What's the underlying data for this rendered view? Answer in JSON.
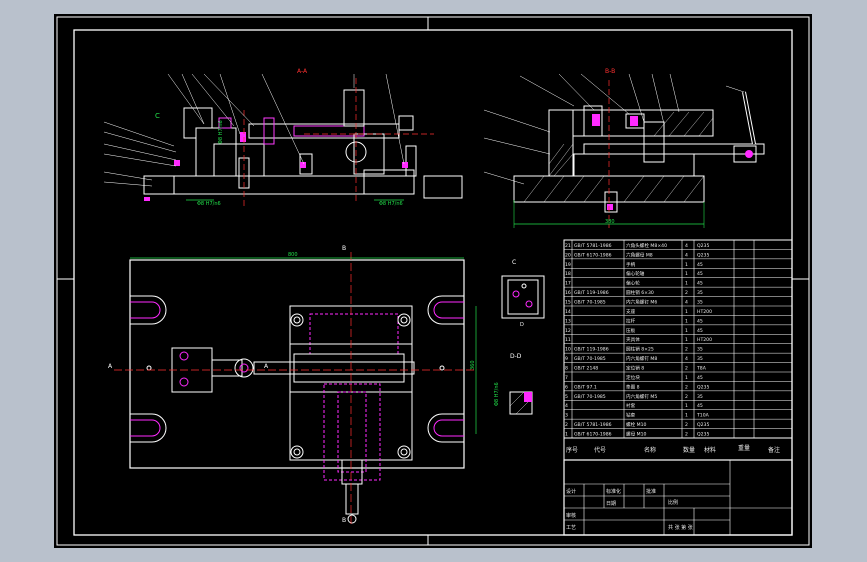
{
  "drawing": {
    "sections": {
      "section_a": "A-A",
      "section_b": "B-B",
      "section_c": "C",
      "section_d": "D-D"
    },
    "dimensions": {
      "plan_width": "800",
      "plan_height": "360",
      "section_b_width": "380",
      "fit_1": "Φ8 H7/n6",
      "fit_2": "Φ8 H7/n6",
      "fit_3": "Φ8 H7/n6",
      "fit_4": "Φ8 H7/n6"
    },
    "markers": {
      "a_left": "A",
      "a_right": "A",
      "b_top": "B",
      "b_bottom": "B",
      "c_top": "C",
      "c_bottom": "D",
      "c_left": "C"
    }
  },
  "parts_table": {
    "rows": [
      {
        "code": "GB/T 5781-1986",
        "name": "六角头螺栓 M8×40",
        "qty": "4",
        "material": "Q235"
      },
      {
        "code": "GB/T 6170-1986",
        "name": "六角螺母 M8",
        "qty": "4",
        "material": "Q235"
      },
      {
        "code": "",
        "name": "手柄",
        "qty": "1",
        "material": "45"
      },
      {
        "code": "",
        "name": "偏心轮轴",
        "qty": "1",
        "material": "45"
      },
      {
        "code": "",
        "name": "偏心轮",
        "qty": "1",
        "material": "45"
      },
      {
        "code": "GB/T 119-1986",
        "name": "圆柱销 6×30",
        "qty": "2",
        "material": "35"
      },
      {
        "code": "GB/T 70-1985",
        "name": "内六角螺钉 M6",
        "qty": "4",
        "material": "35"
      },
      {
        "code": "",
        "name": "支座",
        "qty": "1",
        "material": "HT200"
      },
      {
        "code": "",
        "name": "拉杆",
        "qty": "1",
        "material": "45"
      },
      {
        "code": "",
        "name": "压板",
        "qty": "1",
        "material": "45"
      },
      {
        "code": "",
        "name": "夹具体",
        "qty": "1",
        "material": "HT200"
      },
      {
        "code": "GB/T 119-1986",
        "name": "圆柱销 8×25",
        "qty": "2",
        "material": "35"
      },
      {
        "code": "GB/T 70-1985",
        "name": "内六角螺钉 M8",
        "qty": "4",
        "material": "35"
      },
      {
        "code": "GB/T 2148",
        "name": "定位销 8",
        "qty": "2",
        "material": "T8A"
      },
      {
        "code": "",
        "name": "定位块",
        "qty": "1",
        "material": "45"
      },
      {
        "code": "GB/T 97.1",
        "name": "垫圈 8",
        "qty": "2",
        "material": "Q235"
      },
      {
        "code": "GB/T 70-1985",
        "name": "内六角螺钉 M5",
        "qty": "2",
        "material": "35"
      },
      {
        "code": "",
        "name": "衬套",
        "qty": "1",
        "material": "45"
      },
      {
        "code": "",
        "name": "钻套",
        "qty": "1",
        "material": "T10A"
      },
      {
        "code": "GB/T 5781-1986",
        "name": "螺栓 M10",
        "qty": "2",
        "material": "Q235"
      },
      {
        "code": "GB/T 6170-1986",
        "name": "螺母 M10",
        "qty": "2",
        "material": "Q235"
      }
    ],
    "header": {
      "col_seq": "序号",
      "col_code": "代号",
      "col_name": "名称",
      "col_qty": "数量",
      "col_material": "材料",
      "col_weight": "重量",
      "col_note": "备注"
    }
  },
  "title_block": {
    "design": "设计",
    "check": "审核",
    "process": "工艺",
    "standard": "标准化",
    "approve": "批准",
    "scale": "比例",
    "sheet": "共 张 第 张",
    "date": "日期"
  }
}
